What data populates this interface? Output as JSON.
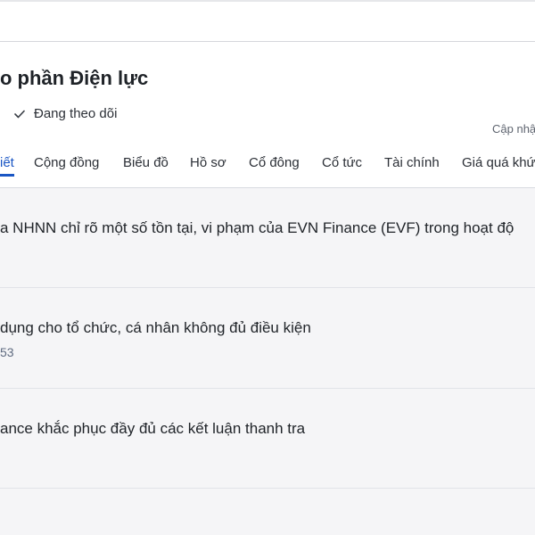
{
  "header": {
    "company_title": "o phần Điện lực",
    "follow_label": "Đang theo dõi",
    "update_label": "Cập nhậ"
  },
  "tabs": [
    {
      "label": "iết",
      "active": true
    },
    {
      "label": "Cộng đồng",
      "active": false
    },
    {
      "label": "Biểu đồ",
      "active": false
    },
    {
      "label": "Hồ sơ",
      "active": false
    },
    {
      "label": "Cổ đông",
      "active": false
    },
    {
      "label": "Cổ tức",
      "active": false
    },
    {
      "label": "Tài chính",
      "active": false
    },
    {
      "label": "Giá quá khứ",
      "active": false
    }
  ],
  "news": [
    {
      "title": "a NHNN chỉ rõ một số tồn tại, vi phạm của EVN Finance (EVF) trong hoạt độ",
      "meta": ""
    },
    {
      "title": "dụng cho tổ chức, cá nhân không đủ điều kiện",
      "meta": "53"
    },
    {
      "title": "ance khắc phục đầy đủ các kết luận thanh tra",
      "meta": ""
    }
  ],
  "colors": {
    "accent": "#1a56c4",
    "background": "#f5f5f7",
    "text": "#1f2328"
  },
  "icons": {
    "follow": "checkmark-icon"
  }
}
